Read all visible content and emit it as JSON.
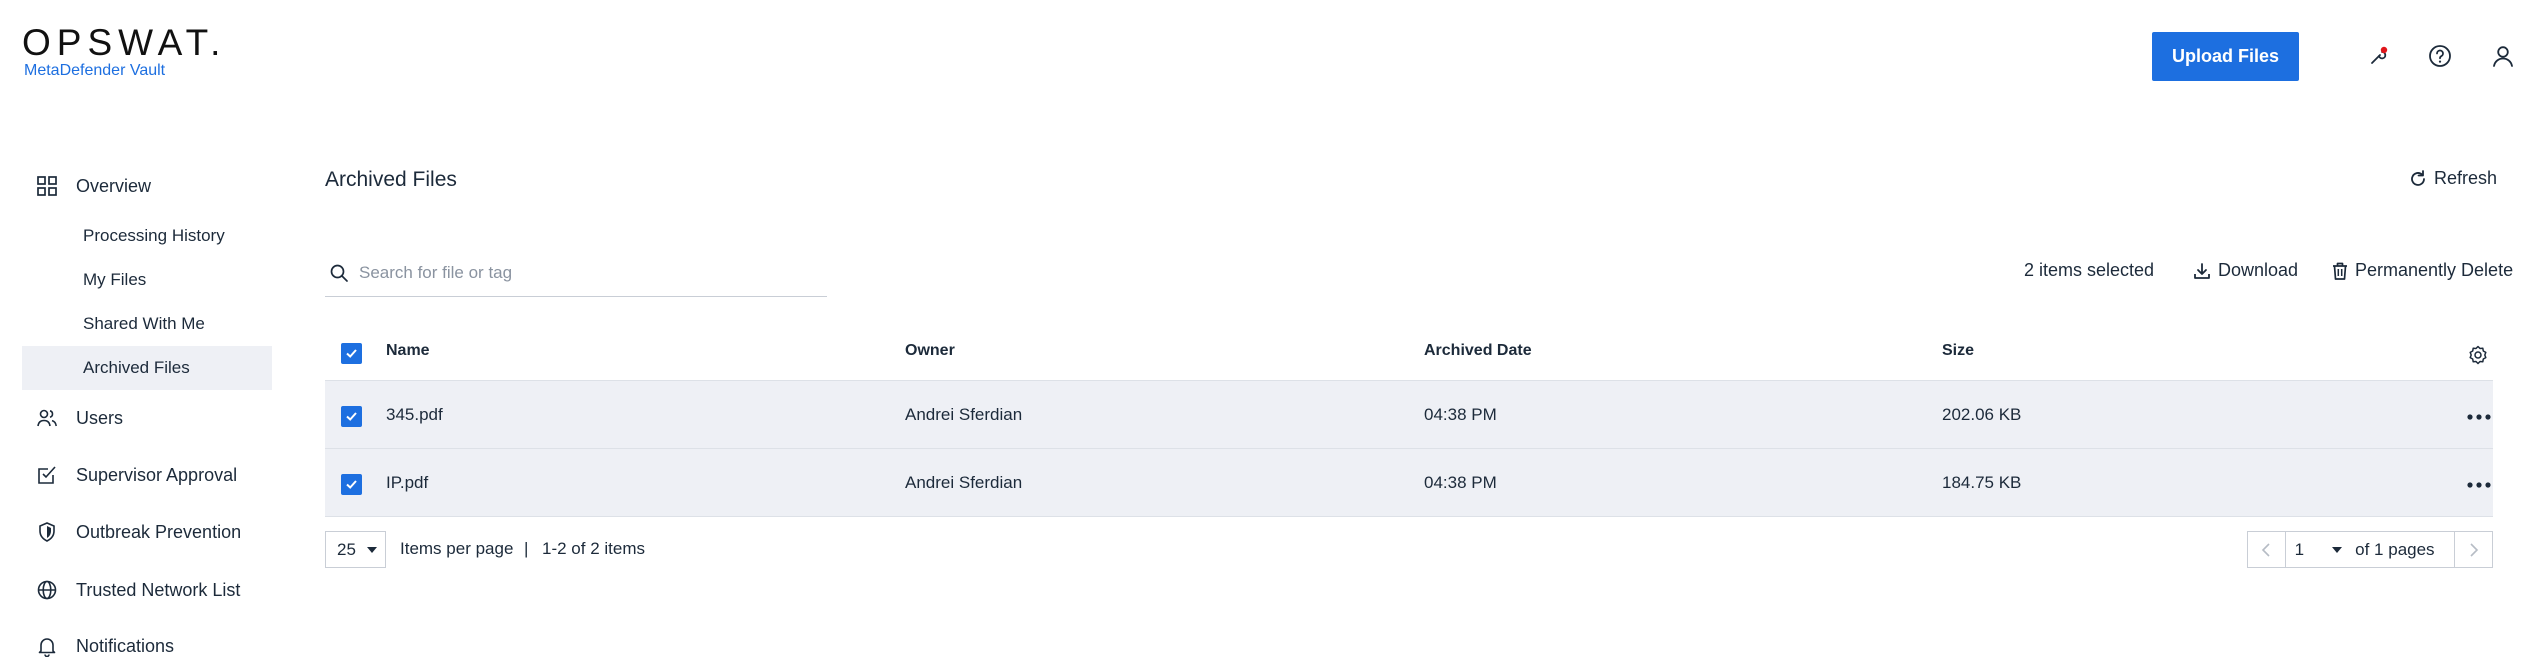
{
  "header": {
    "logo_text": "OPSWAT.",
    "product_name": "MetaDefender Vault",
    "upload_label": "Upload Files",
    "icons": [
      "wrench-icon",
      "help-icon",
      "user-icon"
    ],
    "notification_dot_color": "#e0161b"
  },
  "sidebar": {
    "overview": "Overview",
    "sub_items": [
      "Processing History",
      "My Files",
      "Shared With Me",
      "Archived Files"
    ],
    "active_sub_item": "Archived Files",
    "items": [
      "Users",
      "Supervisor Approval",
      "Outbreak Prevention",
      "Trusted Network List",
      "Notifications"
    ]
  },
  "main": {
    "title": "Archived Files",
    "refresh_label": "Refresh",
    "search_placeholder": "Search for file or tag",
    "selected_text": "2 items selected",
    "download_label": "Download",
    "delete_label": "Permanently Delete"
  },
  "table": {
    "columns": [
      "Name",
      "Owner",
      "Archived Date",
      "Size"
    ],
    "rows": [
      {
        "name": "345.pdf",
        "owner": "Andrei Sferdian",
        "date": "04:38 PM",
        "size": "202.06 KB"
      },
      {
        "name": "IP.pdf",
        "owner": "Andrei Sferdian",
        "date": "04:38 PM",
        "size": "184.75 KB"
      }
    ]
  },
  "pagination": {
    "per_page": "25",
    "per_page_label": "Items per page",
    "separator": "|",
    "range": "1-2 of 2 items",
    "page": "1",
    "of_pages": "of 1 pages"
  },
  "colors": {
    "accent": "#1d6fe0",
    "row_bg": "#eef0f5",
    "text": "#1c2a3a"
  }
}
